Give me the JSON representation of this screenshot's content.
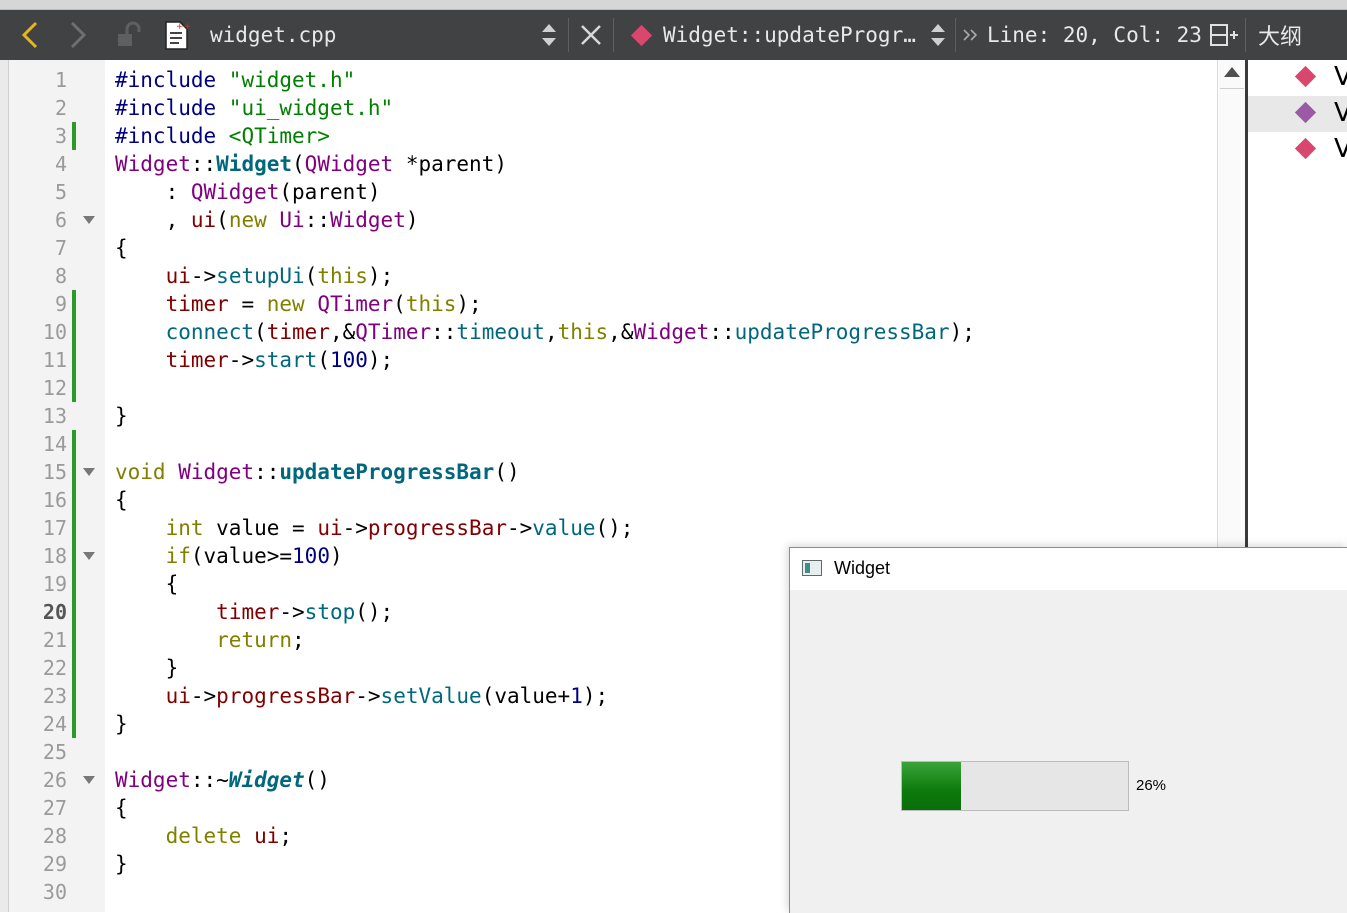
{
  "toolbar": {
    "file_name": "widget.cpp",
    "symbol": "Widget::updateProgr…",
    "cursor_pos": "Line: 20, Col: 23",
    "outline_label": "大纲",
    "symbol_color": "#d9466e"
  },
  "editor": {
    "current_line": 20,
    "lines": [
      {
        "n": "1",
        "changed": false,
        "fold": false
      },
      {
        "n": "2",
        "changed": false,
        "fold": false
      },
      {
        "n": "3",
        "changed": true,
        "fold": false
      },
      {
        "n": "4",
        "changed": false,
        "fold": false
      },
      {
        "n": "5",
        "changed": false,
        "fold": false
      },
      {
        "n": "6",
        "changed": false,
        "fold": true
      },
      {
        "n": "7",
        "changed": false,
        "fold": false
      },
      {
        "n": "8",
        "changed": false,
        "fold": false
      },
      {
        "n": "9",
        "changed": true,
        "fold": false
      },
      {
        "n": "10",
        "changed": true,
        "fold": false
      },
      {
        "n": "11",
        "changed": true,
        "fold": false
      },
      {
        "n": "12",
        "changed": true,
        "fold": false
      },
      {
        "n": "13",
        "changed": false,
        "fold": false
      },
      {
        "n": "14",
        "changed": true,
        "fold": false
      },
      {
        "n": "15",
        "changed": true,
        "fold": true
      },
      {
        "n": "16",
        "changed": true,
        "fold": false
      },
      {
        "n": "17",
        "changed": true,
        "fold": false
      },
      {
        "n": "18",
        "changed": true,
        "fold": true
      },
      {
        "n": "19",
        "changed": true,
        "fold": false
      },
      {
        "n": "20",
        "changed": true,
        "fold": false
      },
      {
        "n": "21",
        "changed": true,
        "fold": false
      },
      {
        "n": "22",
        "changed": true,
        "fold": false
      },
      {
        "n": "23",
        "changed": true,
        "fold": false
      },
      {
        "n": "24",
        "changed": true,
        "fold": false
      },
      {
        "n": "25",
        "changed": false,
        "fold": false
      },
      {
        "n": "26",
        "changed": false,
        "fold": true
      },
      {
        "n": "27",
        "changed": false,
        "fold": false
      },
      {
        "n": "28",
        "changed": false,
        "fold": false
      },
      {
        "n": "29",
        "changed": false,
        "fold": false
      },
      {
        "n": "30",
        "changed": false,
        "fold": false
      }
    ],
    "code": [
      [
        [
          "pp",
          "#include "
        ],
        [
          "str",
          "\"widget.h\""
        ]
      ],
      [
        [
          "pp",
          "#include "
        ],
        [
          "str",
          "\"ui_widget.h\""
        ]
      ],
      [
        [
          "pp",
          "#include "
        ],
        [
          "str",
          "<QTimer>"
        ]
      ],
      [
        [
          "cls",
          "Widget"
        ],
        [
          "",
          "::"
        ],
        [
          "fnb",
          "Widget"
        ],
        [
          "",
          "("
        ],
        [
          "cls",
          "QWidget"
        ],
        [
          "",
          " *"
        ],
        [
          "",
          "parent)"
        ]
      ],
      [
        [
          "",
          "    : "
        ],
        [
          "cls",
          "QWidget"
        ],
        [
          "",
          "(parent)"
        ]
      ],
      [
        [
          "",
          "    , "
        ],
        [
          "mem",
          "ui"
        ],
        [
          "",
          "("
        ],
        [
          "kw",
          "new "
        ],
        [
          "cls",
          "Ui"
        ],
        [
          "",
          "::"
        ],
        [
          "cls",
          "Widget"
        ],
        [
          "",
          ")"
        ]
      ],
      [
        [
          "",
          "{"
        ]
      ],
      [
        [
          "",
          "    "
        ],
        [
          "mem",
          "ui"
        ],
        [
          "",
          "->"
        ],
        [
          "fn",
          "setupUi"
        ],
        [
          "",
          "("
        ],
        [
          "kw",
          "this"
        ],
        [
          "",
          ");"
        ]
      ],
      [
        [
          "",
          "    "
        ],
        [
          "mem",
          "timer"
        ],
        [
          "",
          " = "
        ],
        [
          "kw",
          "new "
        ],
        [
          "cls",
          "QTimer"
        ],
        [
          "",
          "("
        ],
        [
          "kw",
          "this"
        ],
        [
          "",
          ");"
        ]
      ],
      [
        [
          "",
          "    "
        ],
        [
          "fn",
          "connect"
        ],
        [
          "",
          "("
        ],
        [
          "mem",
          "timer"
        ],
        [
          "",
          ",&"
        ],
        [
          "cls",
          "QTimer"
        ],
        [
          "",
          "::"
        ],
        [
          "fn",
          "timeout"
        ],
        [
          "",
          ","
        ],
        [
          "kw",
          "this"
        ],
        [
          "",
          ",&"
        ],
        [
          "cls",
          "Widget"
        ],
        [
          "",
          "::"
        ],
        [
          "fn",
          "updateProgressBar"
        ],
        [
          "",
          ");"
        ]
      ],
      [
        [
          "",
          "    "
        ],
        [
          "mem",
          "timer"
        ],
        [
          "",
          "->"
        ],
        [
          "fn",
          "start"
        ],
        [
          "",
          "("
        ],
        [
          "num",
          "100"
        ],
        [
          "",
          ");"
        ]
      ],
      [
        [
          "",
          ""
        ]
      ],
      [
        [
          "",
          "}"
        ]
      ],
      [
        [
          "",
          ""
        ]
      ],
      [
        [
          "kw",
          "void "
        ],
        [
          "cls",
          "Widget"
        ],
        [
          "",
          "::"
        ],
        [
          "fnb",
          "updateProgressBar"
        ],
        [
          "",
          "()"
        ]
      ],
      [
        [
          "",
          "{"
        ]
      ],
      [
        [
          "",
          "    "
        ],
        [
          "kw",
          "int "
        ],
        [
          "",
          "value = "
        ],
        [
          "mem",
          "ui"
        ],
        [
          "",
          "->"
        ],
        [
          "mem",
          "progressBar"
        ],
        [
          "",
          "->"
        ],
        [
          "fn",
          "value"
        ],
        [
          "",
          "();"
        ]
      ],
      [
        [
          "",
          "    "
        ],
        [
          "kw",
          "if"
        ],
        [
          "",
          "(value>="
        ],
        [
          "num",
          "100"
        ],
        [
          "",
          ")"
        ]
      ],
      [
        [
          "",
          "    {"
        ]
      ],
      [
        [
          "",
          "        "
        ],
        [
          "mem",
          "timer"
        ],
        [
          "",
          "->"
        ],
        [
          "fn",
          "stop"
        ],
        [
          "",
          "();"
        ]
      ],
      [
        [
          "",
          "        "
        ],
        [
          "kw",
          "return"
        ],
        [
          "",
          ";"
        ]
      ],
      [
        [
          "",
          "    }"
        ]
      ],
      [
        [
          "",
          "    "
        ],
        [
          "mem",
          "ui"
        ],
        [
          "",
          "->"
        ],
        [
          "mem",
          "progressBar"
        ],
        [
          "",
          "->"
        ],
        [
          "fn",
          "setValue"
        ],
        [
          "",
          "(value+"
        ],
        [
          "num",
          "1"
        ],
        [
          "",
          ");"
        ]
      ],
      [
        [
          "",
          "}"
        ]
      ],
      [
        [
          "",
          ""
        ]
      ],
      [
        [
          "cls",
          "Widget"
        ],
        [
          "",
          "::~"
        ],
        [
          "fni",
          "Widget"
        ],
        [
          "",
          "()"
        ]
      ],
      [
        [
          "",
          "{"
        ]
      ],
      [
        [
          "",
          "    "
        ],
        [
          "kw",
          "delete "
        ],
        [
          "mem",
          "ui"
        ],
        [
          "",
          ";"
        ]
      ],
      [
        [
          "",
          "}"
        ]
      ],
      [
        [
          "",
          ""
        ]
      ]
    ]
  },
  "outline": {
    "items": [
      {
        "text": "V",
        "color": "#d9466e",
        "selected": false
      },
      {
        "text": "V",
        "color": "#9b59a6",
        "selected": true
      },
      {
        "text": "V",
        "color": "#d9466e",
        "selected": false
      }
    ]
  },
  "widget_window": {
    "title": "Widget",
    "progress_value": 26,
    "progress_text": "26%",
    "progress_color": "#0d7a0d"
  }
}
